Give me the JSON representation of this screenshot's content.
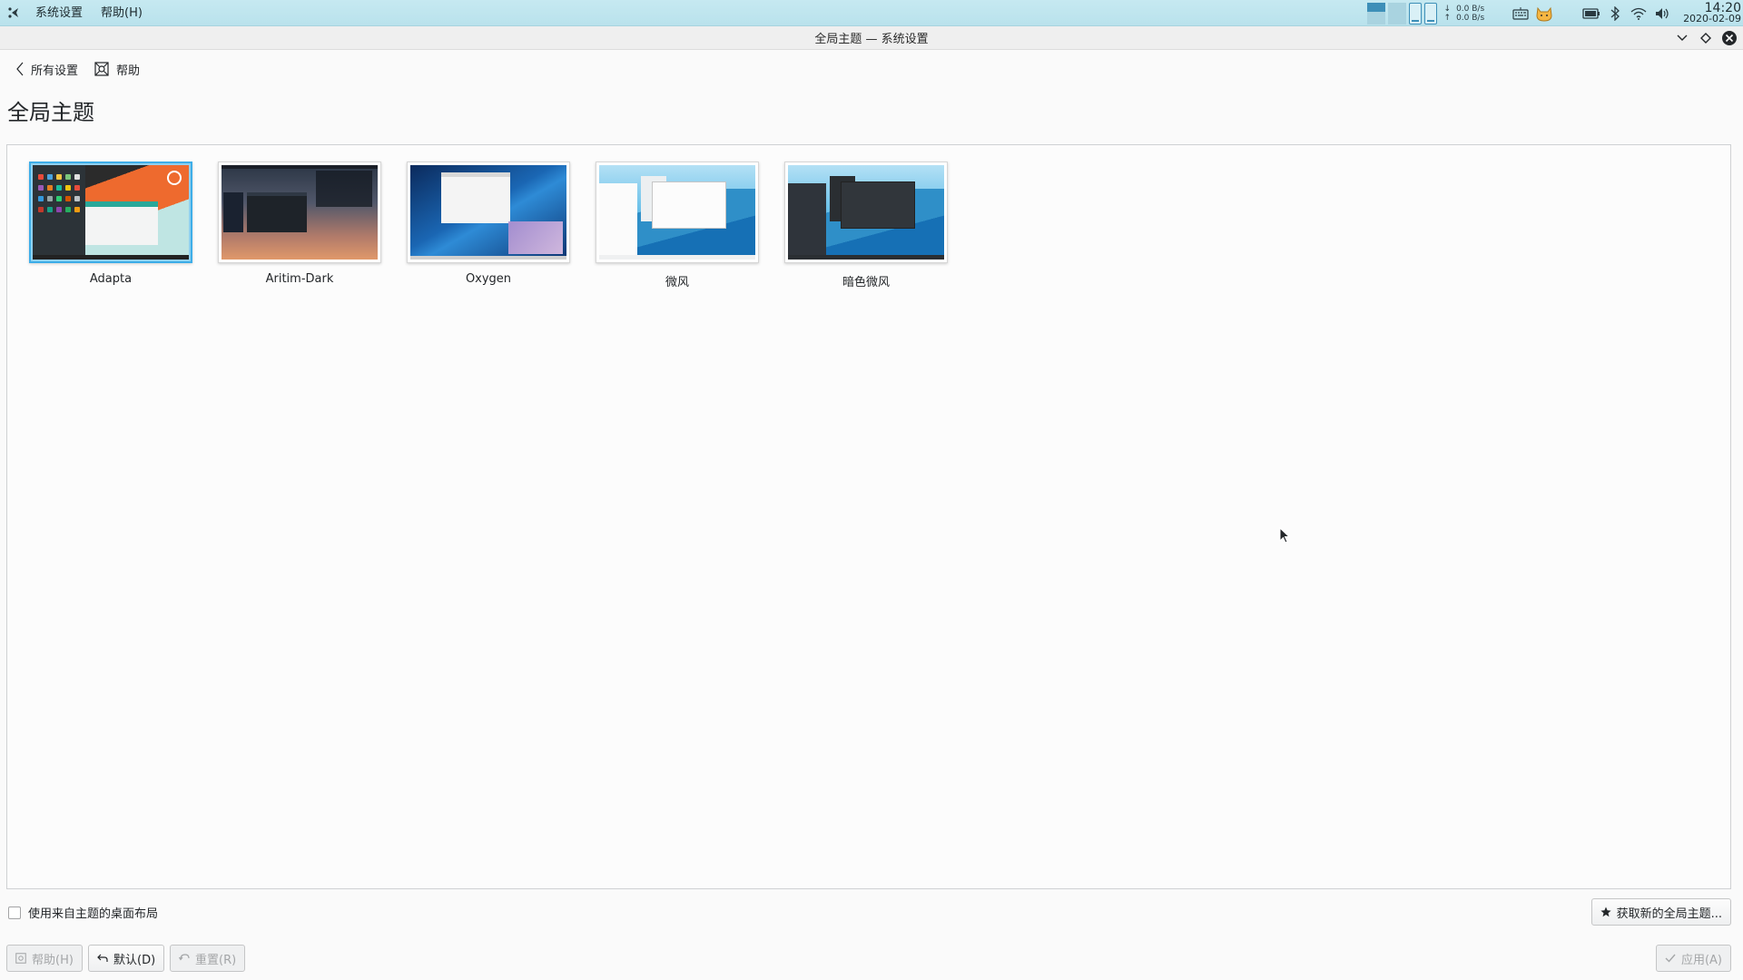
{
  "panel": {
    "menu": [
      "系统设置",
      "帮助(H)"
    ],
    "net_down": "0.0 B/s",
    "net_up": "0.0 B/s",
    "time": "14:20",
    "date": "2020-02-09"
  },
  "window": {
    "title": "全局主题 — 系统设置"
  },
  "nav": {
    "back_label": "所有设置",
    "help_label": "帮助"
  },
  "page_title": "全局主题",
  "themes": [
    {
      "name": "Adapta",
      "selected": true
    },
    {
      "name": "Aritim-Dark",
      "selected": false
    },
    {
      "name": "Oxygen",
      "selected": false
    },
    {
      "name": "微风",
      "selected": false
    },
    {
      "name": "暗色微风",
      "selected": false
    }
  ],
  "bottom": {
    "use_layout_label": "使用来自主题的桌面布局",
    "use_layout_checked": false,
    "get_new_label": "获取新的全局主题...",
    "help_label": "帮助(H)",
    "default_label": "默认(D)",
    "reset_label": "重置(R)",
    "apply_label": "应用(A)"
  },
  "colors": {
    "accent": "#3daee9",
    "panel": "#c6e9f1"
  }
}
